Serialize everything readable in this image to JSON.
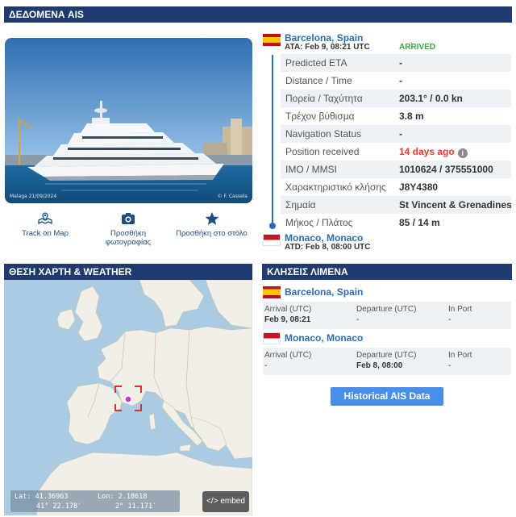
{
  "headers": {
    "ais": "ΔΕΔΟΜΕΝΑ AIS",
    "map": "ΘΕΣΗ ΧΑΡΤΗ & WEATHER",
    "port_calls": "ΚΛΗΣΕΙΣ ΛΙΜΕΝΑ"
  },
  "photo": {
    "caption_left": "Malaga 21/09/2024",
    "caption_right": "© F. Cassela"
  },
  "actions": {
    "track": "Track on Map",
    "add_photo_line1": "Προσθήκη",
    "add_photo_line2": "φωτογραφίας",
    "add_fleet": "Προσθήκη στο στόλο"
  },
  "voyage": {
    "destination": {
      "place": "Barcelona, Spain",
      "time": "ATA: Feb 9, 08:21 UTC",
      "status": "ARRIVED",
      "flag": "spain-flag"
    },
    "origin": {
      "place": "Monaco, Monaco",
      "time": "ATD: Feb 8, 08:00 UTC",
      "flag": "monaco-flag"
    }
  },
  "info": {
    "predicted_eta": {
      "label": "Predicted ETA",
      "value": "-"
    },
    "distance_time": {
      "label": "Distance / Time",
      "value": "-"
    },
    "course_speed": {
      "label": "Πορεία / Ταχύτητα",
      "value": "203.1° / 0.0 kn"
    },
    "draught": {
      "label": "Τρέχον βύθισμα",
      "value": "3.8 m"
    },
    "nav_status": {
      "label": "Navigation Status",
      "value": "-"
    },
    "position_received": {
      "label": "Position received",
      "value": "14 days ago",
      "info_icon": "i"
    },
    "imo_mmsi": {
      "label": "IMO / MMSI",
      "value": "1010624 / 375551000"
    },
    "callsign": {
      "label": "Χαρακτηριστικό κλήσης",
      "value": "J8Y4380"
    },
    "flag": {
      "label": "Σημαία",
      "value": "St Vincent & Grenadines"
    },
    "length_beam": {
      "label": "Μήκος / Πλάτος",
      "value": "85 / 14 m"
    }
  },
  "map": {
    "lat_decimal": "Lat: 41.36963",
    "lon_decimal": "Lon: 2.18618",
    "lat_dms": "41° 22.178′",
    "lon_dms": "2° 11.171′",
    "embed_label": "</> embed"
  },
  "port_calls": [
    {
      "place": "Barcelona, Spain",
      "flag": "spain-flag",
      "arrival_label": "Arrival (UTC)",
      "arrival": "Feb 9, 08:21",
      "departure_label": "Departure (UTC)",
      "departure": "-",
      "inport_label": "In Port",
      "inport": "-"
    },
    {
      "place": "Monaco, Monaco",
      "flag": "monaco-flag",
      "arrival_label": "Arrival (UTC)",
      "arrival": "-",
      "departure_label": "Departure (UTC)",
      "departure": "Feb 8, 08:00",
      "inport_label": "In Port",
      "inport": "-"
    }
  ],
  "historical_button": "Historical AIS Data",
  "colors": {
    "header_bg": "#1f3a6e",
    "link": "#2a6db0",
    "arrived": "#39a83b",
    "alert": "#e53a2e",
    "button": "#4a8fe7"
  }
}
